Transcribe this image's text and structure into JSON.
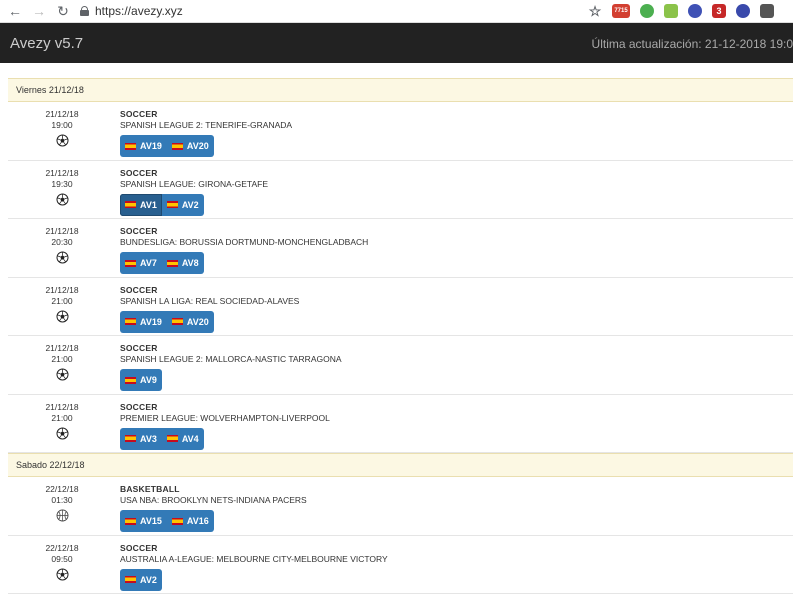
{
  "browser": {
    "url": "https://avezy.xyz",
    "badge_count": "7715",
    "ext_badge": "3"
  },
  "app": {
    "brand": "Avezy v5.7",
    "updated": "Última actualización: 21-12-2018 19:0"
  },
  "days": [
    {
      "label": "Viernes 21/12/18",
      "events": [
        {
          "date": "21/12/18",
          "time": "19:00",
          "sport_icon": "soccer-ball-icon",
          "sport": "SOCCER",
          "match": "SPANISH LEAGUE 2: TENERIFE-GRANADA",
          "streams": [
            "AV19",
            "AV20"
          ]
        },
        {
          "date": "21/12/18",
          "time": "19:30",
          "sport_icon": "soccer-ball-icon",
          "sport": "SOCCER",
          "match": "SPANISH LEAGUE: GIRONA-GETAFE",
          "streams": [
            "AV1",
            "AV2"
          ]
        },
        {
          "date": "21/12/18",
          "time": "20:30",
          "sport_icon": "soccer-ball-icon",
          "sport": "SOCCER",
          "match": "BUNDESLIGA: BORUSSIA DORTMUND-MONCHENGLADBACH",
          "streams": [
            "AV7",
            "AV8"
          ]
        },
        {
          "date": "21/12/18",
          "time": "21:00",
          "sport_icon": "soccer-ball-icon",
          "sport": "SOCCER",
          "match": "SPANISH LA LIGA: REAL SOCIEDAD-ALAVES",
          "streams": [
            "AV19",
            "AV20"
          ]
        },
        {
          "date": "21/12/18",
          "time": "21:00",
          "sport_icon": "soccer-ball-icon",
          "sport": "SOCCER",
          "match": "SPANISH LEAGUE 2: MALLORCA-NASTIC TARRAGONA",
          "streams": [
            "AV9"
          ]
        },
        {
          "date": "21/12/18",
          "time": "21:00",
          "sport_icon": "soccer-ball-icon",
          "sport": "SOCCER",
          "match": "PREMIER LEAGUE: WOLVERHAMPTON-LIVERPOOL",
          "streams": [
            "AV3",
            "AV4"
          ]
        }
      ]
    },
    {
      "label": "Sabado 22/12/18",
      "events": [
        {
          "date": "22/12/18",
          "time": "01:30",
          "sport_icon": "basketball-icon",
          "sport": "BASKETBALL",
          "match": "USA NBA: BROOKLYN NETS-INDIANA PACERS",
          "streams": [
            "AV15",
            "AV16"
          ]
        },
        {
          "date": "22/12/18",
          "time": "09:50",
          "sport_icon": "soccer-ball-icon",
          "sport": "SOCCER",
          "match": "AUSTRALIA A-LEAGUE: MELBOURNE CITY-MELBOURNE VICTORY",
          "streams": [
            "AV2"
          ]
        }
      ]
    }
  ],
  "colors": {
    "appbar": "#222222",
    "day_header": "#fcf8e3",
    "stream_button": "#337ab7",
    "stream_button_active": "#285f8f"
  }
}
